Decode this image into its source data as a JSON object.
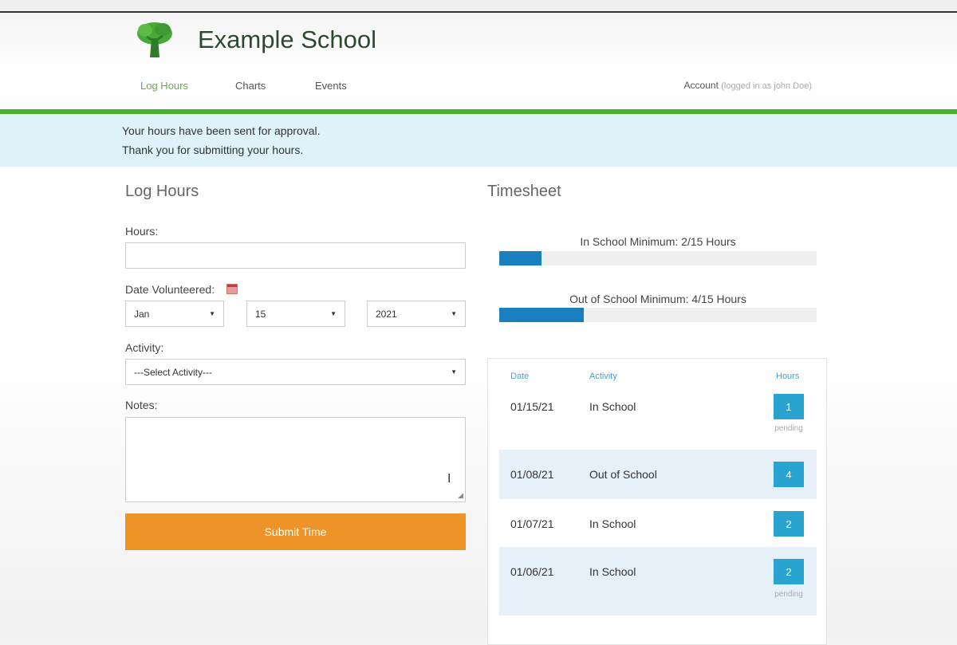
{
  "header": {
    "brand": "Example School",
    "nav": [
      {
        "label": "Log Hours"
      },
      {
        "label": "Charts"
      },
      {
        "label": "Events"
      }
    ],
    "account_label": "Account",
    "account_status": "(logged in as john Doe)",
    "accent_color": "#4caf30"
  },
  "notice": {
    "line1": "Your hours have been sent for approval.",
    "line2": "Thank you for submitting your hours."
  },
  "log_hours": {
    "title": "Log Hours",
    "hours_label": "Hours:",
    "hours_value": "",
    "date_label": "Date Volunteered:",
    "month": "Jan",
    "day": "15",
    "year": "2021",
    "activity_label": "Activity:",
    "activity_value": "---Select Activity---",
    "notes_label": "Notes:",
    "notes_value": "",
    "submit_label": "Submit Time",
    "submit_color": "#ed9328"
  },
  "timesheet": {
    "title": "Timesheet",
    "progress": [
      {
        "label": "In School Minimum: 2/15 Hours",
        "value": 2,
        "max": 15
      },
      {
        "label": "Out of School Minimum: 4/15 Hours",
        "value": 4,
        "max": 15
      }
    ],
    "columns": {
      "date": "Date",
      "activity": "Activity",
      "hours": "Hours"
    },
    "entries": [
      {
        "date": "01/15/21",
        "activity": "In School",
        "hours": "1",
        "status": "pending"
      },
      {
        "date": "01/08/21",
        "activity": "Out of School",
        "hours": "4",
        "status": ""
      },
      {
        "date": "01/07/21",
        "activity": "In School",
        "hours": "2",
        "status": ""
      },
      {
        "date": "01/06/21",
        "activity": "In School",
        "hours": "2",
        "status": "pending"
      }
    ],
    "badge_color": "#29a3d0",
    "bar_color": "#1a7fbd"
  }
}
